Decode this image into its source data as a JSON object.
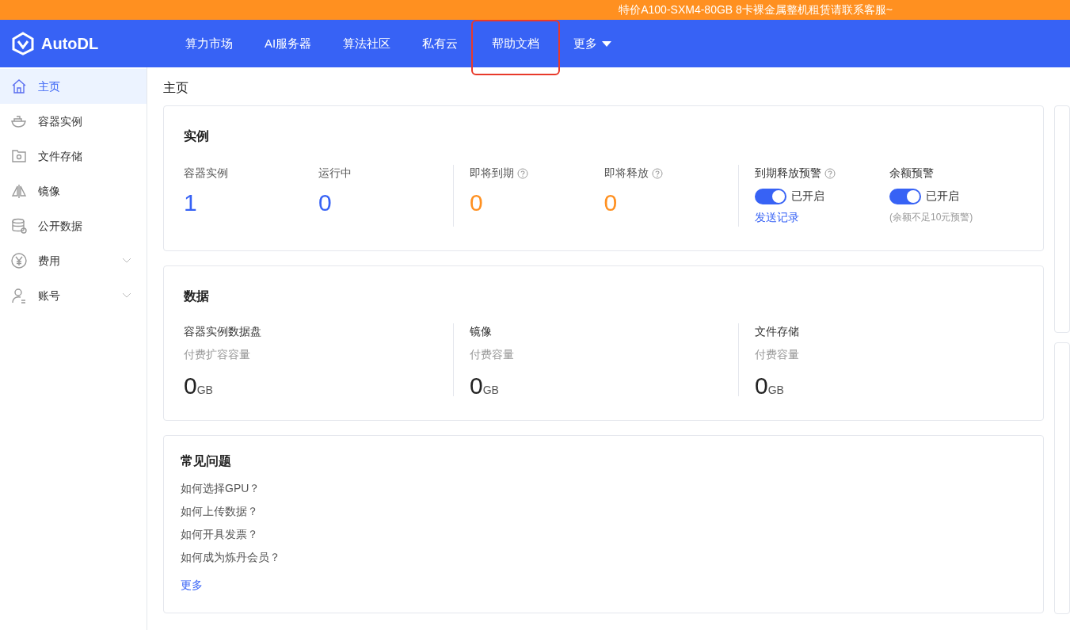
{
  "banner": {
    "text": "特价A100-SXM4-80GB 8卡裸金属整机租赁请联系客服~"
  },
  "header": {
    "logo": "AutoDL",
    "nav": [
      {
        "label": "算力市场",
        "highlighted": false,
        "dropdown": false
      },
      {
        "label": "AI服务器",
        "highlighted": false,
        "dropdown": false
      },
      {
        "label": "算法社区",
        "highlighted": false,
        "dropdown": false
      },
      {
        "label": "私有云",
        "highlighted": false,
        "dropdown": false
      },
      {
        "label": "帮助文档",
        "highlighted": true,
        "dropdown": false
      },
      {
        "label": "更多",
        "highlighted": false,
        "dropdown": true
      }
    ]
  },
  "sidebar": {
    "items": [
      {
        "label": "主页",
        "selected": true,
        "expandable": false
      },
      {
        "label": "容器实例",
        "selected": false,
        "expandable": false
      },
      {
        "label": "文件存储",
        "selected": false,
        "expandable": false
      },
      {
        "label": "镜像",
        "selected": false,
        "expandable": false
      },
      {
        "label": "公开数据",
        "selected": false,
        "expandable": false
      },
      {
        "label": "费用",
        "selected": false,
        "expandable": true
      },
      {
        "label": "账号",
        "selected": false,
        "expandable": true
      }
    ]
  },
  "page_title": "主页",
  "instances": {
    "title": "实例",
    "groups": [
      [
        {
          "label": "容器实例",
          "value": "1",
          "color": "#3762f5",
          "help": false
        },
        {
          "label": "运行中",
          "value": "0",
          "color": "#3762f5",
          "help": false
        }
      ],
      [
        {
          "label": "即将到期",
          "value": "0",
          "color": "#ff9020",
          "help": true
        },
        {
          "label": "即将释放",
          "value": "0",
          "color": "#ff9020",
          "help": true
        }
      ]
    ],
    "alerts": [
      {
        "label": "到期释放预警",
        "help": true,
        "on": true,
        "state": "已开启",
        "link": "发送记录"
      },
      {
        "label": "余额预警",
        "help": false,
        "on": true,
        "state": "已开启",
        "note": "(余额不足10元预警)"
      }
    ]
  },
  "data": {
    "title": "数据",
    "columns": [
      {
        "label": "容器实例数据盘",
        "sub": "付费扩容容量",
        "value": "0",
        "unit": "GB"
      },
      {
        "label": "镜像",
        "sub": "付费容量",
        "value": "0",
        "unit": "GB"
      },
      {
        "label": "文件存储",
        "sub": "付费容量",
        "value": "0",
        "unit": "GB"
      }
    ]
  },
  "faq": {
    "title": "常见问题",
    "items": [
      "如何选择GPU？",
      "如何上传数据？",
      "如何开具发票？",
      "如何成为炼丹会员？"
    ],
    "more": "更多"
  }
}
